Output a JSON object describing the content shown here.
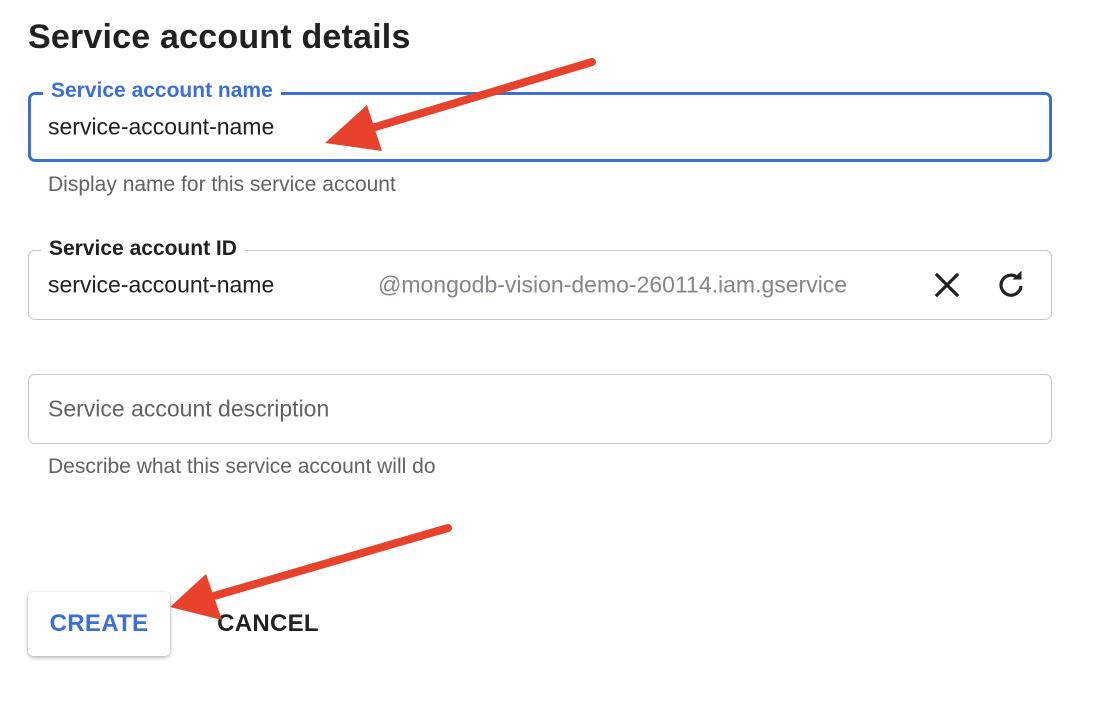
{
  "heading": "Service account details",
  "name_field": {
    "label": "Service account name",
    "value": "service-account-name",
    "hint": "Display name for this service account"
  },
  "id_field": {
    "label": "Service account ID",
    "value": "service-account-name",
    "suffix": "@mongodb-vision-demo-260114.iam.gservice",
    "clear_icon": "close-icon",
    "regenerate_icon": "refresh-icon"
  },
  "description_field": {
    "placeholder": "Service account description",
    "hint": "Describe what this service account will do"
  },
  "actions": {
    "create_label": "CREATE",
    "cancel_label": "CANCEL"
  },
  "colors": {
    "accent": "#3c6fd3",
    "annotation_arrow": "#e8412c",
    "text": "#202124",
    "muted": "#5f6368"
  }
}
